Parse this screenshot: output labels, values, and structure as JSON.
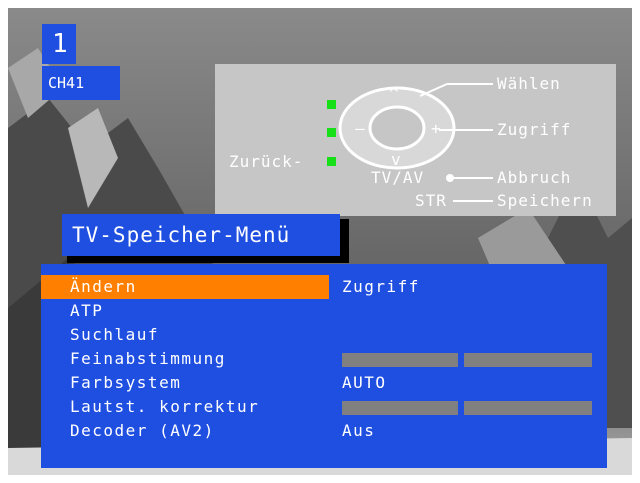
{
  "channel": {
    "number": "1",
    "name": "CH41"
  },
  "remote": {
    "labels": {
      "back": "Zurück-",
      "select": "Wählen",
      "access": "Zugriff",
      "cancel": "Abbruch",
      "store": "Speichern",
      "tv_av": "TV/AV",
      "str": "STR"
    },
    "symbols": {
      "up": "^",
      "down": "v",
      "minus": "—",
      "plus": "+"
    },
    "led_color": "#18e018"
  },
  "menu": {
    "title": "TV-Speicher-Menü",
    "items": [
      {
        "label": "Ändern",
        "value": "Zugriff",
        "selected": true
      },
      {
        "label": "ATP",
        "value": ""
      },
      {
        "label": "Suchlauf",
        "value": ""
      },
      {
        "label": "Feinabstimmung",
        "value": "",
        "bars": true
      },
      {
        "label": "Farbsystem",
        "value": "AUTO"
      },
      {
        "label": "Lautst. korrektur",
        "value": "",
        "bars": true
      },
      {
        "label": "Decoder (AV2)",
        "value": "Aus"
      }
    ]
  },
  "colors": {
    "menu_bg": "#1f4fe0",
    "highlight": "#ff7f00",
    "remote_panel": "#c6c6c6"
  }
}
